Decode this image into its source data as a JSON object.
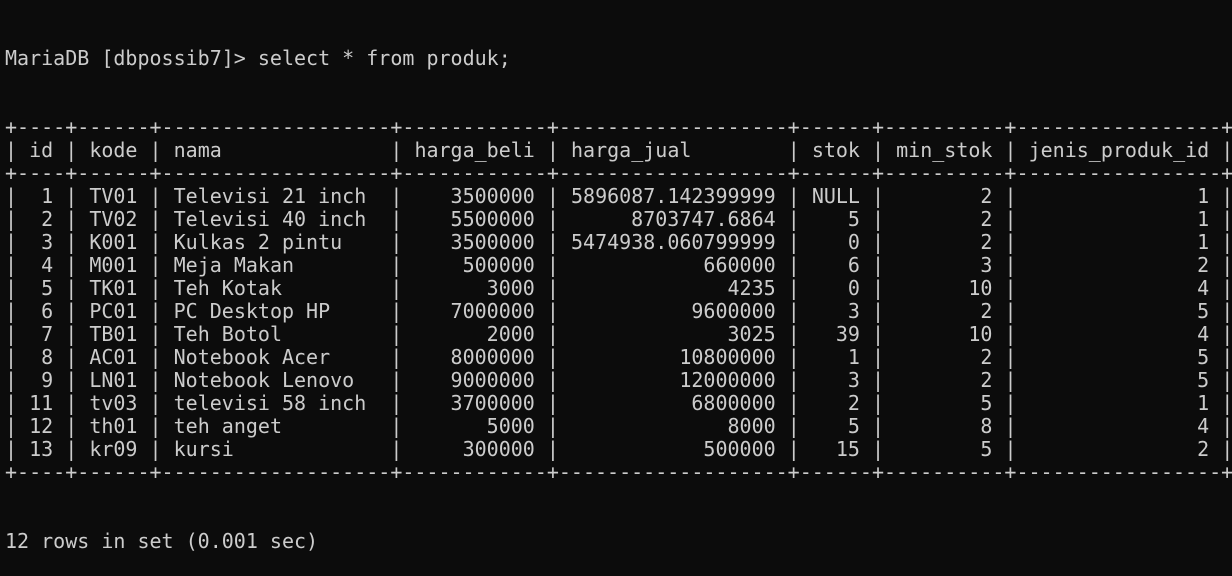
{
  "prompt": "MariaDB [dbpossib7]>",
  "command": "select * from produk;",
  "columns": [
    {
      "name": "id",
      "align": "right",
      "width": 2
    },
    {
      "name": "kode",
      "align": "left",
      "width": 4
    },
    {
      "name": "nama",
      "align": "left",
      "width": 17
    },
    {
      "name": "harga_beli",
      "align": "right",
      "width": 10
    },
    {
      "name": "harga_jual",
      "align": "right",
      "width": 17
    },
    {
      "name": "stok",
      "align": "right",
      "width": 4
    },
    {
      "name": "min_stok",
      "align": "right",
      "width": 8
    },
    {
      "name": "jenis_produk_id",
      "align": "right",
      "width": 15
    }
  ],
  "rows": [
    [
      "1",
      "TV01",
      "Televisi 21 inch",
      "3500000",
      "5896087.142399999",
      "NULL",
      "2",
      "1"
    ],
    [
      "2",
      "TV02",
      "Televisi 40 inch",
      "5500000",
      "8703747.6864",
      "5",
      "2",
      "1"
    ],
    [
      "3",
      "K001",
      "Kulkas 2 pintu",
      "3500000",
      "5474938.060799999",
      "0",
      "2",
      "1"
    ],
    [
      "4",
      "M001",
      "Meja Makan",
      "500000",
      "660000",
      "6",
      "3",
      "2"
    ],
    [
      "5",
      "TK01",
      "Teh Kotak",
      "3000",
      "4235",
      "0",
      "10",
      "4"
    ],
    [
      "6",
      "PC01",
      "PC Desktop HP",
      "7000000",
      "9600000",
      "3",
      "2",
      "5"
    ],
    [
      "7",
      "TB01",
      "Teh Botol",
      "2000",
      "3025",
      "39",
      "10",
      "4"
    ],
    [
      "8",
      "AC01",
      "Notebook Acer",
      "8000000",
      "10800000",
      "1",
      "2",
      "5"
    ],
    [
      "9",
      "LN01",
      "Notebook Lenovo",
      "9000000",
      "12000000",
      "3",
      "2",
      "5"
    ],
    [
      "11",
      "tv03",
      "televisi 58 inch",
      "3700000",
      "6800000",
      "2",
      "5",
      "1"
    ],
    [
      "12",
      "th01",
      "teh anget",
      "5000",
      "8000",
      "5",
      "8",
      "4"
    ],
    [
      "13",
      "kr09",
      "kursi",
      "300000",
      "500000",
      "15",
      "5",
      "2"
    ]
  ],
  "status": "12 rows in set (0.001 sec)"
}
